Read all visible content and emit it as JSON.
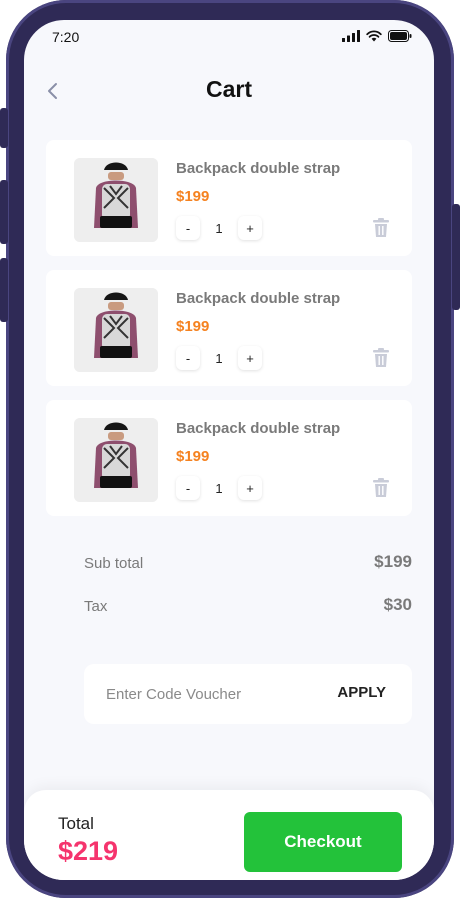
{
  "status_bar": {
    "time": "7:20",
    "icons": [
      "cellular-signal-icon",
      "wifi-icon",
      "battery-icon"
    ]
  },
  "header": {
    "title": "Cart",
    "back_icon": "chevron-left-icon"
  },
  "cart_items": [
    {
      "name": "Backpack double strap",
      "price": "$199",
      "minus_label": "-",
      "quantity": "1",
      "plus_label": "+",
      "delete_icon": "trash-icon"
    },
    {
      "name": "Backpack double strap",
      "price": "$199",
      "minus_label": "-",
      "quantity": "1",
      "plus_label": "+",
      "delete_icon": "trash-icon"
    },
    {
      "name": "Backpack double strap",
      "price": "$199",
      "minus_label": "-",
      "quantity": "1",
      "plus_label": "+",
      "delete_icon": "trash-icon"
    }
  ],
  "summary": {
    "subtotal_label": "Sub total",
    "subtotal_value": "$199",
    "tax_label": "Tax",
    "tax_value": "$30"
  },
  "voucher": {
    "placeholder": "Enter Code Voucher",
    "value": "",
    "apply_label": "APPLY"
  },
  "footer": {
    "total_label": "Total",
    "total_value": "$219",
    "checkout_label": "Checkout"
  },
  "colors": {
    "device_frame": "#2f2a56",
    "screen_bg": "#f7f8fc",
    "price_orange": "#f58220",
    "total_pink": "#f5346d",
    "checkout_green": "#23c23a",
    "muted_text": "#7a7a7a"
  }
}
